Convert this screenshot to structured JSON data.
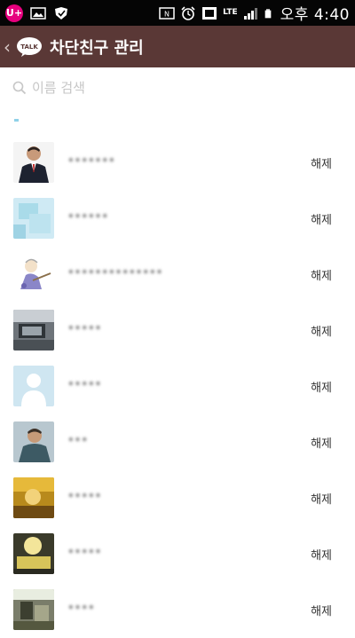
{
  "status_bar": {
    "carrier": "U+",
    "lte_label": "LTE",
    "time": "오후 4:40"
  },
  "header": {
    "title": "차단친구 관리",
    "logo_text": "TALK",
    "header_color": "#5a3836"
  },
  "search": {
    "placeholder": "이름 검색"
  },
  "friends": [
    {
      "name": "•••••••",
      "action": "해제",
      "avatar": "suit-person"
    },
    {
      "name": "••••••",
      "action": "해제",
      "avatar": "light-blue"
    },
    {
      "name": "••••••••••••••",
      "action": "해제",
      "avatar": "cartoon"
    },
    {
      "name": "•••••",
      "action": "해제",
      "avatar": "gray-photo"
    },
    {
      "name": "•••••",
      "action": "해제",
      "avatar": "default-silhouette"
    },
    {
      "name": "•••",
      "action": "해제",
      "avatar": "person-photo"
    },
    {
      "name": "•••••",
      "action": "해제",
      "avatar": "gold-photo"
    },
    {
      "name": "•••••",
      "action": "해제",
      "avatar": "dark-yellow-photo"
    },
    {
      "name": "••••",
      "action": "해제",
      "avatar": "outdoor-photo"
    }
  ]
}
